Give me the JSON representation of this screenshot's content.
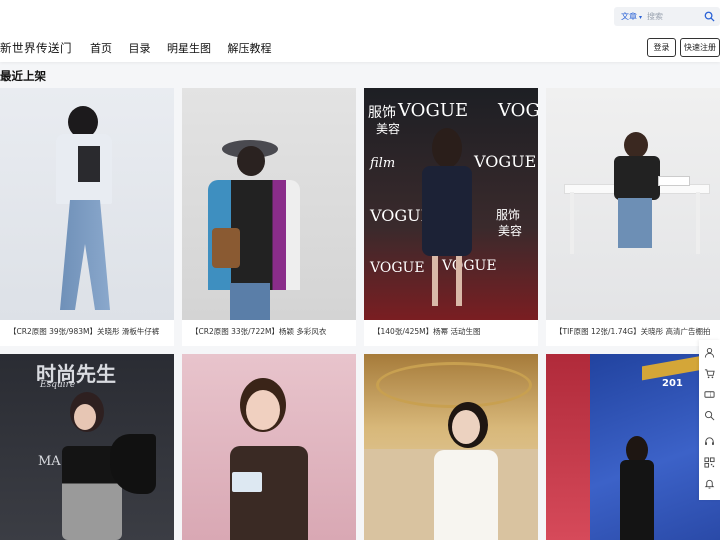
{
  "header": {
    "logo": "新世界传送门",
    "nav": [
      "首页",
      "目录",
      "明星生图",
      "解压教程"
    ],
    "search": {
      "type": "文章",
      "placeholder": "搜索"
    },
    "login": "登录",
    "register": "快速注册"
  },
  "section_title": "最近上架",
  "cards": [
    "【CR2原图 39张/983M】关晓彤 滑板牛仔裤",
    "【CR2原图 33张/722M】杨颖 多彩风衣",
    "【140张/425M】杨幂 活动生图",
    "【TIF原图 12张/1.74G】关晓彤 高清广告棚拍",
    "",
    "",
    "",
    ""
  ],
  "photo_text": {
    "vogue": "VOGUE",
    "fushi": "服饰",
    "meirong": "美容",
    "film": "film",
    "esquire_cn": "时尚先生",
    "esquire": "Esquire",
    "ma": "MA",
    "num": "201"
  },
  "colors": {
    "accent": "#2a62d6",
    "background": "#f5f6f8"
  }
}
